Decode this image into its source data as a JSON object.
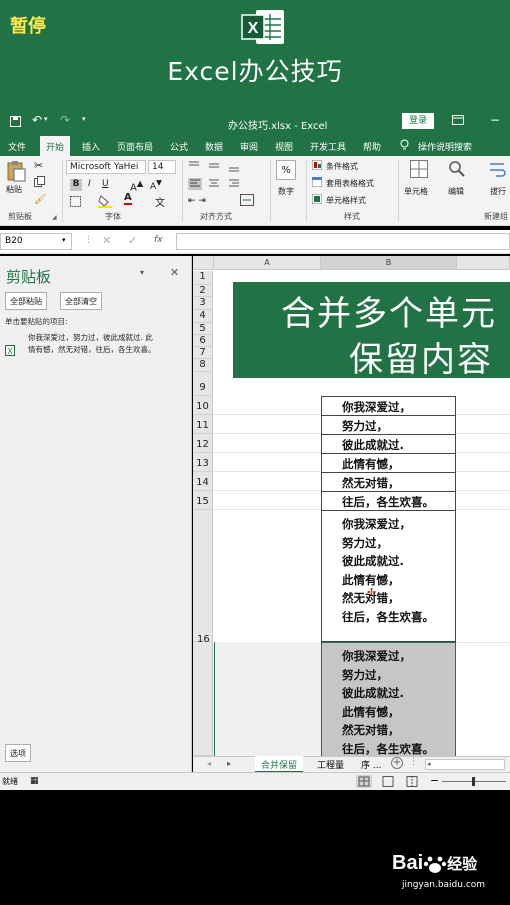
{
  "overlay": {
    "pause_label": "暂停"
  },
  "brand": {
    "logo_letter": "X",
    "title": "Excel办公技巧"
  },
  "titlebar": {
    "file_title": "办公技巧.xlsx  -  Excel",
    "login_label": "登录"
  },
  "ribbon_tabs": [
    "文件",
    "开始",
    "插入",
    "页面布局",
    "公式",
    "数据",
    "审阅",
    "视图",
    "开发工具",
    "帮助"
  ],
  "ribbon_search": "操作说明搜索",
  "ribbon": {
    "paste_label": "粘贴",
    "font_name": "Microsoft YaHei",
    "font_size": "14",
    "number_label": "数字",
    "conditional_format": "条件格式",
    "table_format": "套用表格格式",
    "cell_style": "单元格样式",
    "cells_label": "单元格",
    "edit_label": "编辑",
    "wrap_label": "拔行",
    "groups": {
      "clipboard": "剪贴板",
      "font": "字体",
      "align": "对齐方式",
      "styles": "样式",
      "new_group": "新建组"
    }
  },
  "formula_bar": {
    "name_box": "B20",
    "fx": "fx"
  },
  "clipboard_pane": {
    "title": "剪贴板",
    "paste_all": "全部粘贴",
    "clear_all": "全部清空",
    "hint": "单击要粘贴的项目:",
    "item_text": "你我深爱过，努力过，彼此成就过. 此情有憾，然无对错，往后，各生欢喜。",
    "options_label": "选项"
  },
  "sheet": {
    "columns": [
      "A",
      "B"
    ],
    "merged_title_line1": "合并多个单元",
    "merged_title_line2": "保留内容",
    "rows_1_9": [
      "1",
      "2",
      "3",
      "4",
      "5",
      "6",
      "7",
      "8",
      "9"
    ],
    "rows_10_15": [
      {
        "num": "10",
        "text": "你我深爱过，"
      },
      {
        "num": "11",
        "text": "努力过，"
      },
      {
        "num": "12",
        "text": "彼此成就过."
      },
      {
        "num": "13",
        "text": "此情有憾，"
      },
      {
        "num": "14",
        "text": "然无对错，"
      },
      {
        "num": "15",
        "text": "往后，各生欢喜。"
      }
    ],
    "block_lines": [
      "你我深爱过，",
      "努力过，",
      "彼此成就过.",
      "此情有憾，",
      "然无对错，",
      "往后，各生欢喜。"
    ],
    "row_16": "16"
  },
  "sheet_tabs": [
    "合并保留",
    "工程量",
    "序 ..."
  ],
  "status": {
    "ready": "就绪"
  },
  "watermark": {
    "brand": "Bai",
    "brand2": "经验",
    "url": "jingyan.baidu.com"
  },
  "colors": {
    "excel_green": "#217346",
    "pause_yellow": "#ffe84a"
  }
}
